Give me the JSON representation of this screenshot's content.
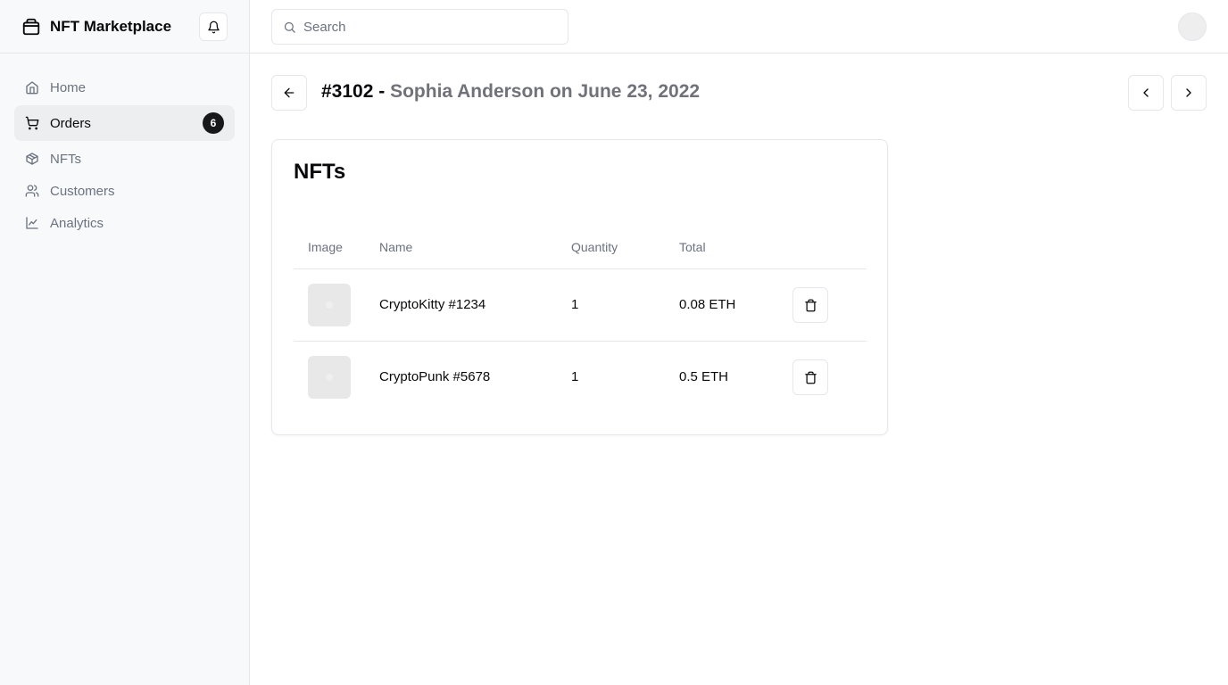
{
  "app": {
    "title": "NFT Marketplace"
  },
  "sidebar": {
    "items": [
      {
        "label": "Home",
        "icon": "home-icon",
        "active": false
      },
      {
        "label": "Orders",
        "icon": "cart-icon",
        "active": true,
        "badge": "6"
      },
      {
        "label": "NFTs",
        "icon": "package-icon",
        "active": false
      },
      {
        "label": "Customers",
        "icon": "users-icon",
        "active": false
      },
      {
        "label": "Analytics",
        "icon": "line-chart-icon",
        "active": false
      }
    ]
  },
  "search": {
    "placeholder": "Search",
    "value": ""
  },
  "order": {
    "id": "#3102",
    "separator": " - ",
    "meta": "Sophia Anderson on June 23, 2022"
  },
  "card": {
    "title": "NFTs",
    "columns": [
      "Image",
      "Name",
      "Quantity",
      "Total"
    ],
    "rows": [
      {
        "name": "CryptoKitty #1234",
        "quantity": "1",
        "total": "0.08 ETH"
      },
      {
        "name": "CryptoPunk #5678",
        "quantity": "1",
        "total": "0.5 ETH"
      }
    ]
  },
  "colors": {
    "sidebar_bg": "#f8f9fa",
    "active_bg": "#eceef0",
    "badge_bg": "#18181b",
    "border": "#e5e7eb",
    "muted_text": "#6b7280"
  }
}
